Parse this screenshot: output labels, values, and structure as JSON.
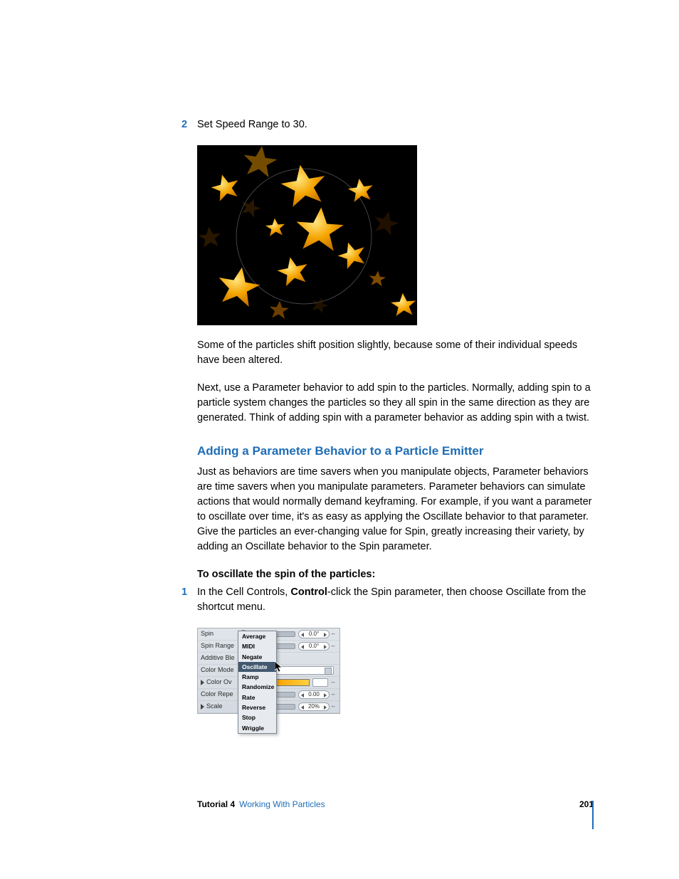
{
  "step2": {
    "num": "2",
    "text": "Set Speed Range to 30."
  },
  "para1": "Some of the particles shift position slightly, because some of their individual speeds have been altered.",
  "para2": "Next, use a Parameter behavior to add spin to the particles. Normally, adding spin to a particle system changes the particles so they all spin in the same direction as they are generated. Think of adding spin with a parameter behavior as adding spin with a twist.",
  "heading": "Adding a Parameter Behavior to a Particle Emitter",
  "para3": "Just as behaviors are time savers when you manipulate objects, Parameter behaviors are time savers when you manipulate parameters. Parameter behaviors can simulate actions that would normally demand keyframing. For example, if you want a parameter to oscillate over time, it's as easy as applying the Oscillate behavior to that parameter. Give the particles an ever-changing value for Spin, greatly increasing their variety, by adding an Oscillate behavior to the Spin parameter.",
  "boldLead": "To oscillate the spin of the particles:",
  "step1": {
    "num": "1",
    "pre": "In the Cell Controls, ",
    "bold": "Control",
    "post": "-click the Spin parameter, then choose Oscillate from the shortcut menu."
  },
  "panel": {
    "rows": {
      "spin": {
        "label": "Spin",
        "value": "0.0°"
      },
      "spinRange": {
        "label": "Spin Range",
        "value": "0.0°"
      },
      "additive": {
        "label": "Additive Ble"
      },
      "colorMode": {
        "label": "Color Mode"
      },
      "colorOver": {
        "label": "Color Ov"
      },
      "colorRepe": {
        "label": "Color Repe",
        "value": "0.00"
      },
      "scale": {
        "label": "Scale",
        "value": "20%"
      }
    },
    "menu": [
      "Average",
      "MIDI",
      "Negate",
      "Oscillate",
      "Ramp",
      "Randomize",
      "Rate",
      "Reverse",
      "Stop",
      "Wriggle"
    ],
    "menuSelected": "Oscillate"
  },
  "footer": {
    "tutorial": "Tutorial 4",
    "link": "Working With Particles",
    "page": "201"
  }
}
